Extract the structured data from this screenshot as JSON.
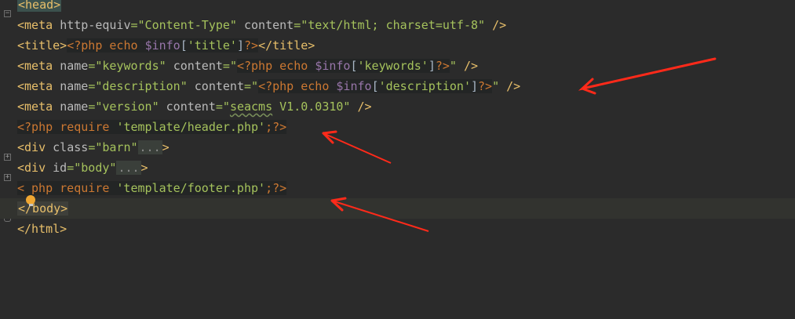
{
  "editor": {
    "lines": [
      {
        "parts": [
          "<head>"
        ]
      },
      {
        "parts": [
          "<meta",
          "http-equiv",
          "=",
          "\"Content-Type\"",
          "content",
          "=",
          "\"text/html; charset=utf-8\"",
          "/>"
        ]
      },
      {
        "parts": [
          "<title>",
          "<?php",
          "echo",
          "$info",
          "[",
          "'title'",
          "]",
          "?>",
          "</title>"
        ]
      },
      {
        "parts": [
          "<meta",
          "name",
          "=",
          "\"keywords\"",
          "content",
          "=",
          "\"",
          "<?php",
          "echo",
          "$info",
          "[",
          "'keywords'",
          "]",
          "?>",
          "\"",
          "/>"
        ]
      },
      {
        "parts": [
          "<meta",
          "name",
          "=",
          "\"description\"",
          "content",
          "=",
          "\"",
          "<?php",
          "echo",
          "$info",
          "[",
          "'description'",
          "]",
          "?>",
          "\"",
          "/>"
        ]
      },
      {
        "parts": [
          "<meta",
          "name",
          "=",
          "\"version\"",
          "content",
          "=",
          "\"",
          "seacms",
          " V1.0.0310\"",
          "/>"
        ]
      },
      {
        "parts": [
          "<?php",
          "require",
          "'template/header.php'",
          ";",
          "?>"
        ]
      },
      {
        "parts": [
          "<div",
          "class",
          "=",
          "\"barn\"",
          "...",
          ">"
        ]
      },
      {
        "parts": [
          "<div",
          "id",
          "=",
          "\"body\"",
          "...",
          ">"
        ]
      },
      {
        "parts": [
          "<",
          "php",
          "require",
          "'template/footer.php'",
          ";",
          "?>"
        ]
      },
      {
        "parts": [
          "</body>"
        ]
      },
      {
        "parts": [
          "</html>"
        ]
      }
    ]
  },
  "colors": {
    "background": "#2b2b2b",
    "tag": "#e8bf6a",
    "string": "#a5c25c",
    "php": "#cc7832",
    "variable": "#9876aa",
    "annotation_arrow": "#ff2a1a"
  },
  "icons": {
    "fold": "fold-toggle-icon",
    "bulb": "lightbulb-icon",
    "arrow": "red-arrow-annotation"
  }
}
